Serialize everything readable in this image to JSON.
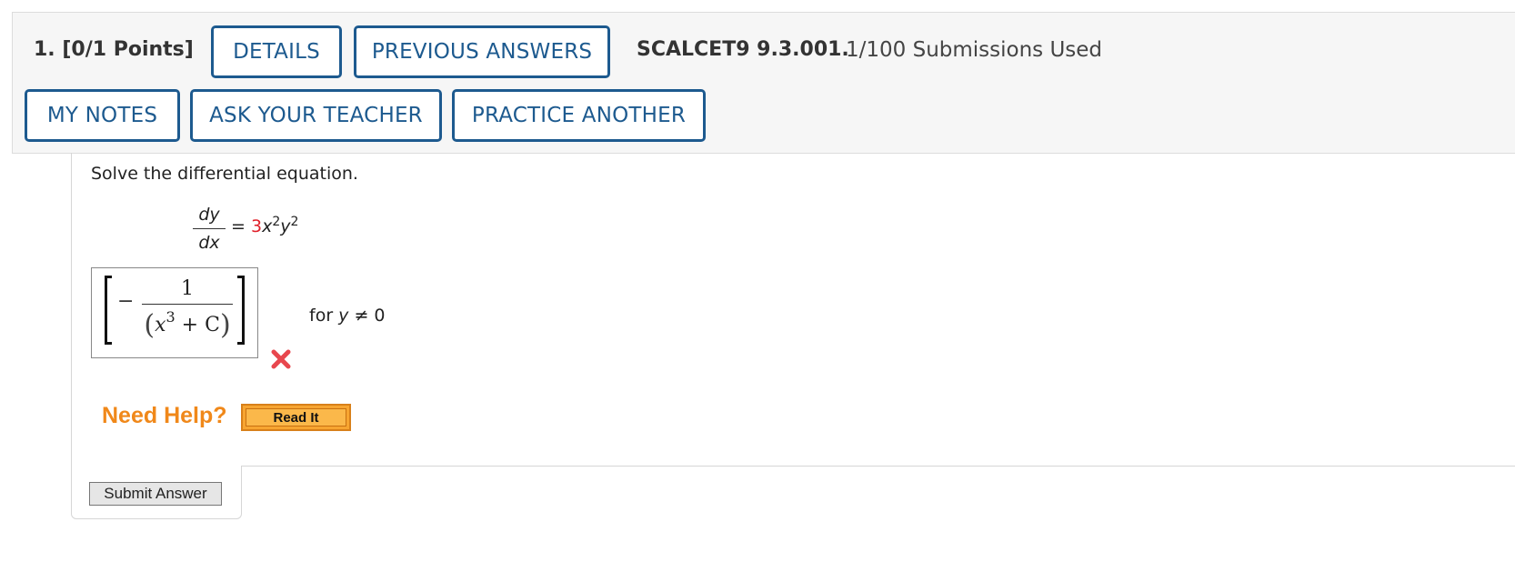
{
  "header": {
    "question_number": "1.",
    "points": "[0/1 Points]",
    "details_label": "DETAILS",
    "previous_answers_label": "PREVIOUS ANSWERS",
    "assignment_code": "SCALCET9 9.3.001.",
    "submissions": "1/100 Submissions Used",
    "my_notes_label": "MY NOTES",
    "ask_teacher_label": "ASK YOUR TEACHER",
    "practice_another_label": "PRACTICE ANOTHER"
  },
  "question": {
    "prompt": "Solve the differential equation.",
    "lhs_numerator": "dy",
    "lhs_denominator": "dx",
    "equals": "=",
    "coefficient": "3",
    "rhs_x": "x",
    "rhs_x_exp": "2",
    "rhs_y": "y",
    "rhs_y_exp": "2",
    "coefficient_color": "#e0202a"
  },
  "answer": {
    "sign": "−",
    "numerator": "1",
    "open_paren": "(",
    "x": "x",
    "x_exp": "3",
    "plus_c": " + C",
    "close_paren": ")",
    "status_icon": "wrong-x-icon",
    "condition_prefix": "for ",
    "condition_var": "y",
    "condition_rest": " ≠ 0"
  },
  "help": {
    "need_help_label": "Need Help?",
    "read_it_label": "Read It"
  },
  "submit": {
    "label": "Submit Answer"
  },
  "colors": {
    "button_accent": "#1d5a8f",
    "need_help": "#f0881a",
    "wrong": "#e8474e"
  }
}
